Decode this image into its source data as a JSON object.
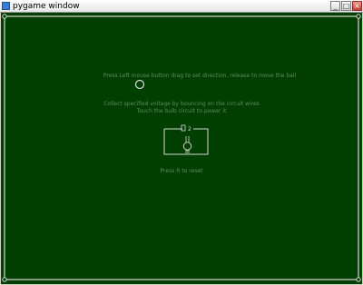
{
  "window": {
    "title": "pygame window",
    "controls": {
      "minimize": "_",
      "maximize": "□",
      "close": "×"
    }
  },
  "game": {
    "background_color": "#003f00",
    "wire_color": "#d8d8d8",
    "text_color": "#5a8f5a",
    "instructions": {
      "aim": "Press Left mouse button drag to set direction, release to move the ball",
      "goal_line1": "Collect specified voltage by bouncing on the circuit wires",
      "goal_line2": "Touch the bulb circuit to power it",
      "reset": "Press R to reset"
    },
    "circuit": {
      "voltage_label": "2"
    }
  }
}
